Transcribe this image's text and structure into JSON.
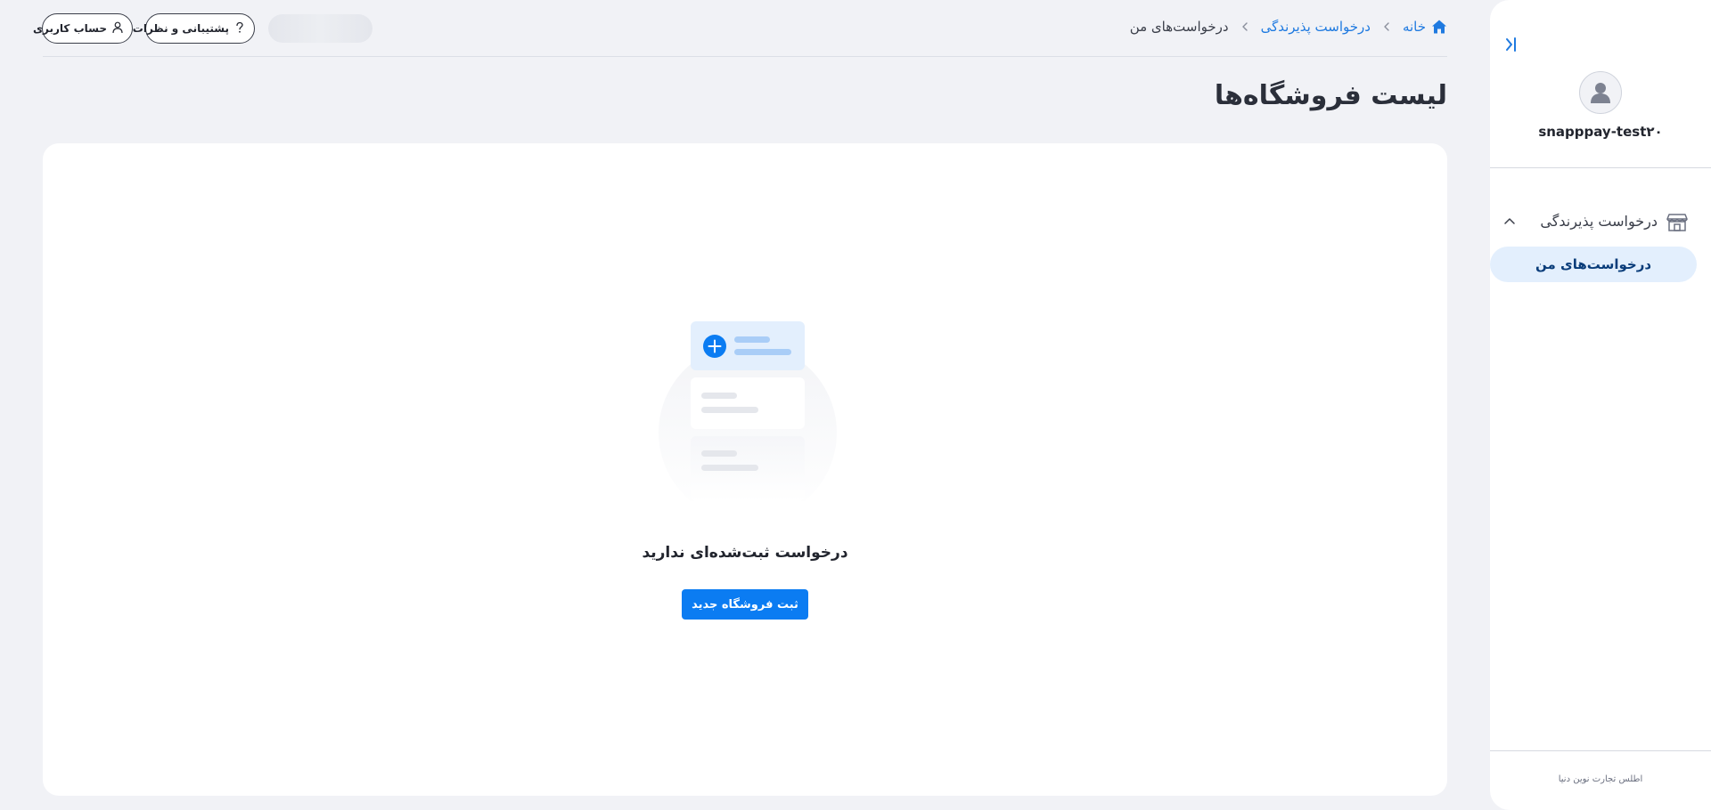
{
  "sidebar": {
    "username": "snapppay-test۲۰",
    "menu_group": {
      "label": "درخواست پذیرندگی",
      "icon": "store-icon",
      "expanded": true
    },
    "menu_items": [
      {
        "label": "درخواست‌های من",
        "active": true
      }
    ],
    "footer": "اطلس تجارت نوین دنیا",
    "collapse_icon": "collapse-sidebar-icon"
  },
  "header": {
    "breadcrumb": [
      {
        "label": "خانه",
        "icon": "home-icon",
        "link": true
      },
      {
        "label": "درخواست پذیرندگی",
        "link": true
      },
      {
        "label": "درخواست‌های من",
        "link": false
      }
    ],
    "support_label": "پشتیبانی و نظرات",
    "account_label": "حساب کاربری"
  },
  "main": {
    "title": "لیست فروشگاه‌ها",
    "empty_message": "درخواست ثبت‌شده‌ای ندارید",
    "new_store_label": "ثبت فروشگاه جدید"
  },
  "colors": {
    "accent": "#0b7cf2",
    "link": "#1f7ae0",
    "background": "#f1f2f6",
    "active_item_bg": "#e3effd"
  }
}
